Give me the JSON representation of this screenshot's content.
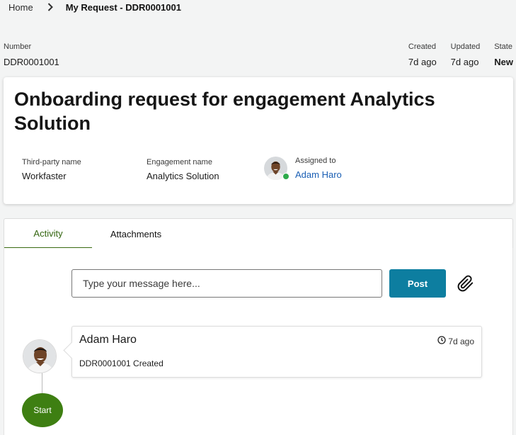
{
  "breadcrumb": {
    "home": "Home",
    "current": "My Request - DDR0001001"
  },
  "meta": {
    "number_label": "Number",
    "number_value": "DDR0001001",
    "created_label": "Created",
    "created_value": "7d ago",
    "updated_label": "Updated",
    "updated_value": "7d ago",
    "state_label": "State",
    "state_value": "New"
  },
  "header": {
    "title": "Onboarding request for engagement Analytics Solution",
    "third_party_label": "Third-party name",
    "third_party_value": "Workfaster",
    "engagement_label": "Engagement name",
    "engagement_value": "Analytics Solution",
    "assigned_label": "Assigned to",
    "assigned_value": "Adam Haro",
    "presence_color": "#2eaa4b"
  },
  "tabs": [
    {
      "label": "Activity",
      "active": true
    },
    {
      "label": "Attachments",
      "active": false
    }
  ],
  "composer": {
    "placeholder": "Type your message here...",
    "post_label": "Post",
    "attach_icon": "paperclip-icon"
  },
  "activity": {
    "author": "Adam Haro",
    "time": "7d ago",
    "text": "DDR0001001 Created",
    "time_icon": "clock-icon",
    "start_label": "Start"
  },
  "colors": {
    "accent_green": "#3e7f12",
    "post_button": "#0d7ea0",
    "link_blue": "#1a5fb4"
  }
}
